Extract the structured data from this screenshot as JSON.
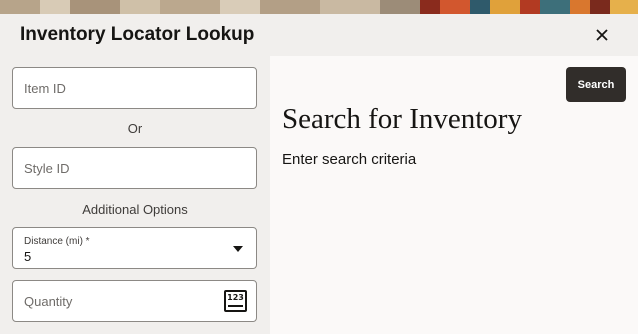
{
  "dialog": {
    "title": "Inventory Locator Lookup",
    "close_icon": "close-icon"
  },
  "form": {
    "item_id_placeholder": "Item ID",
    "or_text": "Or",
    "style_id_placeholder": "Style ID",
    "additional_options": "Additional Options",
    "distance": {
      "label": "Distance (mi) *",
      "value": "5",
      "icon": "chevron-down-icon"
    },
    "quantity_placeholder": "Quantity",
    "quantity_icon": "number-input-icon",
    "quantity_icon_text": "123"
  },
  "results": {
    "search_label": "Search",
    "title": "Search for Inventory",
    "subtitle": "Enter search criteria"
  },
  "colors": {
    "primary_button": "#312d2a",
    "background": "#f1efed",
    "panel": "#fbf9f8"
  }
}
